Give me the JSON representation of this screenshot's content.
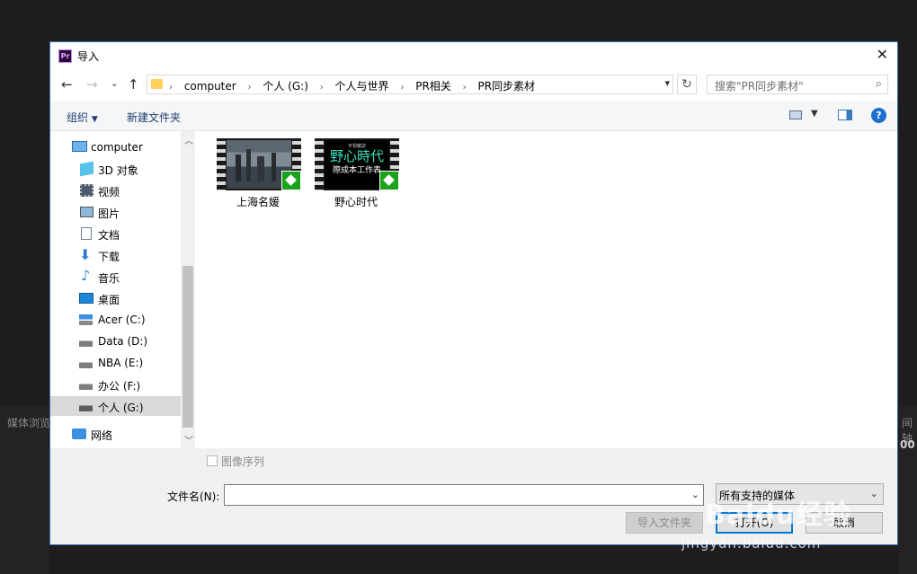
{
  "background": {
    "left_panel_text": "媒体浏览",
    "right_panel_text": "间轴",
    "right_panel_number": "00"
  },
  "dialog": {
    "title": "导入",
    "app_badge": "Pr",
    "breadcrumbs": [
      "computer",
      "个人 (G:)",
      "个人与世界",
      "PR相关",
      "PR同步素材"
    ],
    "search_placeholder": "搜索\"PR同步素材\"",
    "toolbar": {
      "organize_label": "组织",
      "new_folder_label": "新建文件夹"
    },
    "sidebar": {
      "items": [
        {
          "label": "computer",
          "icon": "computer-icon"
        },
        {
          "label": "3D 对象",
          "icon": "3d-objects-icon"
        },
        {
          "label": "视频",
          "icon": "video-icon"
        },
        {
          "label": "图片",
          "icon": "pictures-icon"
        },
        {
          "label": "文档",
          "icon": "documents-icon"
        },
        {
          "label": "下载",
          "icon": "download-icon"
        },
        {
          "label": "音乐",
          "icon": "music-icon"
        },
        {
          "label": "桌面",
          "icon": "desktop-icon"
        },
        {
          "label": "Acer (C:)",
          "icon": "windows-drive-icon"
        },
        {
          "label": "Data (D:)",
          "icon": "drive-icon"
        },
        {
          "label": "NBA (E:)",
          "icon": "drive-icon"
        },
        {
          "label": "办公 (F:)",
          "icon": "drive-icon"
        },
        {
          "label": "个人 (G:)",
          "icon": "drive-icon",
          "selected": true
        },
        {
          "label": "网络",
          "icon": "network-icon"
        }
      ]
    },
    "files": [
      {
        "name": "上海名媛",
        "thumb_text": ""
      },
      {
        "name": "野心时代",
        "thumb_text": "野心時代",
        "thumb_sub": "際成本工作表",
        "thumb_top": "平視雜誌"
      }
    ],
    "image_sequence_label": "图像序列",
    "filename_label": "文件名(N):",
    "filename_value": "",
    "filter_value": "所有支持的媒体",
    "buttons": {
      "import_folder": "导入文件夹",
      "open": "打开(O)",
      "cancel": "取消"
    }
  },
  "watermark": {
    "brand": "Baidu经验",
    "url": "jingyan.baidu.com"
  }
}
